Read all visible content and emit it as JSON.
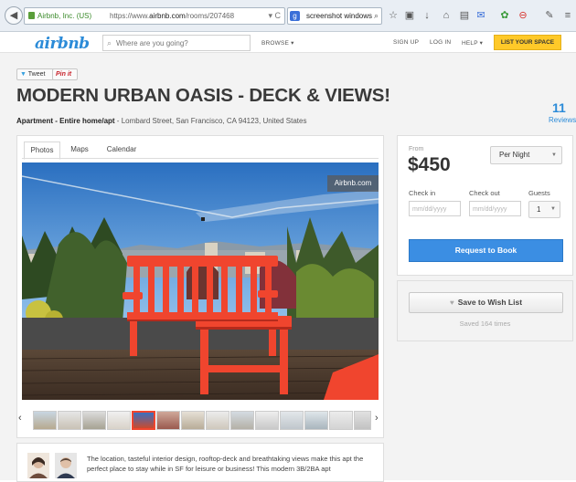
{
  "browser": {
    "back_glyph": "◀",
    "site_identity": "Airbnb, Inc. (US)",
    "url_prefix": "https://www.",
    "url_domain": "airbnb.com",
    "url_path": "/rooms/207468",
    "url_controls": "▾ C",
    "search_engine_glyph": "g",
    "search_query": "screenshot windows",
    "search_icon": "search-icon",
    "toolbar_icons": [
      "star-icon",
      "clipboard-icon",
      "download-icon",
      "home-icon",
      "extension-icon",
      "feedback-icon",
      "puzzle-icon",
      "stop-icon",
      "tools-icon",
      "menu-icon"
    ]
  },
  "header": {
    "logo": "airbnb",
    "search_placeholder": "Where are you going?",
    "browse": "BROWSE ▾",
    "sign_up": "SIGN UP",
    "log_in": "LOG IN",
    "help": "HELP ▾",
    "list_space": "LIST YOUR SPACE",
    "list_space_color": "#ffc929"
  },
  "social": {
    "tweet": "Tweet",
    "pin": "Pin it"
  },
  "listing": {
    "title": "MODERN URBAN OASIS - DECK & VIEWS!",
    "type": "Apartment - Entire home/apt",
    "address": " - Lombard Street, San Francisco, CA 94123, United States",
    "reviews_count": "11",
    "reviews_label": "Reviews",
    "description": "The location, tasteful interior design, rooftop-deck and breathtaking views make this apt the perfect place to stay while in SF for leisure or business! This modern 3B/2BA apt"
  },
  "photos": {
    "tabs": [
      "Photos",
      "Maps",
      "Calendar"
    ],
    "active_tab": "Photos",
    "badge": "Airbnb.com",
    "thumbnail_count": 14,
    "selected_thumbnail": 5,
    "prev": "‹",
    "next": "›"
  },
  "booking": {
    "from_label": "From",
    "price": "$450",
    "period": "Per Night",
    "check_in_label": "Check in",
    "check_out_label": "Check out",
    "guests_label": "Guests",
    "date_placeholder": "mm/dd/yyyy",
    "guests_value": "1",
    "request_button": "Request to Book",
    "request_color": "#3b8ee3",
    "wishlist_button": "Save to Wish List",
    "saved_text": "Saved 164 times"
  }
}
